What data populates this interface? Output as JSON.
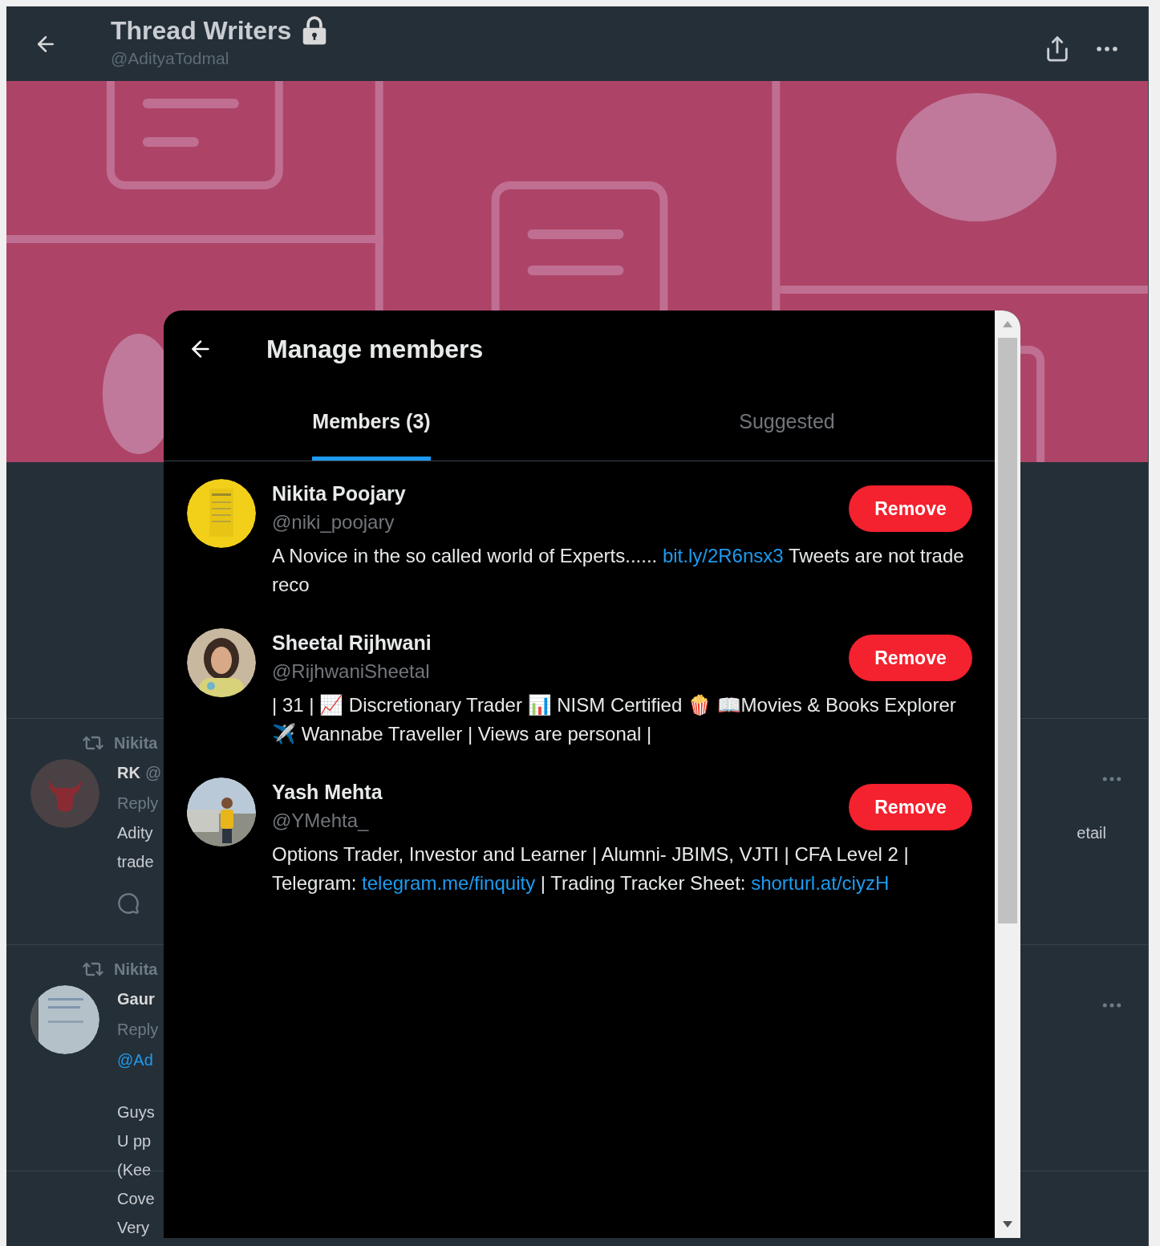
{
  "header": {
    "title": "Thread Writers",
    "handle": "@AdityaTodmal",
    "locked": true
  },
  "banner": {
    "kind": "picture"
  },
  "background_tweets": [
    {
      "retweeted_by": "Nikita",
      "author": "RK",
      "handle": "@",
      "reply_label": "Reply",
      "body_lines": [
        "Adity",
        "trade"
      ],
      "right_text": "etail"
    },
    {
      "retweeted_by": "Nikita",
      "author": "Gaur",
      "reply_label": "Reply",
      "mention": "@Ad",
      "body_lines": [
        "Guys",
        "U pp",
        "(Kee",
        "Cove",
        "Very"
      ]
    }
  ],
  "modal": {
    "title": "Manage members",
    "tabs": [
      {
        "label": "Members (3)",
        "selected": true
      },
      {
        "label": "Suggested",
        "selected": false
      }
    ],
    "members": [
      {
        "name": "Nikita Poojary",
        "handle": "@niki_poojary",
        "button": "Remove",
        "avatar": {
          "kind": "picture"
        },
        "bio": [
          {
            "text": "A Novice in the so called world of Experts...... "
          },
          {
            "text": "bit.ly/2R6nsx3",
            "link": true
          },
          {
            "text": " Tweets are not trade reco"
          }
        ]
      },
      {
        "name": "Sheetal Rijhwani",
        "handle": "@RijhwaniSheetal",
        "button": "Remove",
        "avatar": {
          "kind": "picture"
        },
        "bio": [
          {
            "text": "| 31 | 📈 Discretionary Trader 📊 NISM Certified 🍿 📖Movies & Books Explorer ✈️ Wannabe Traveller | Views are personal |"
          }
        ]
      },
      {
        "name": "Yash Mehta",
        "handle": "@YMehta_",
        "button": "Remove",
        "avatar": {
          "kind": "picture"
        },
        "bio": [
          {
            "text": "Options Trader, Investor and Learner | Alumni- JBIMS, VJTI | CFA Level 2 | Telegram: "
          },
          {
            "text": "telegram.me/finquity",
            "link": true
          },
          {
            "text": " | Trading Tracker Sheet: "
          },
          {
            "text": "shorturl.at/ciyzH",
            "link": true
          }
        ]
      }
    ]
  }
}
